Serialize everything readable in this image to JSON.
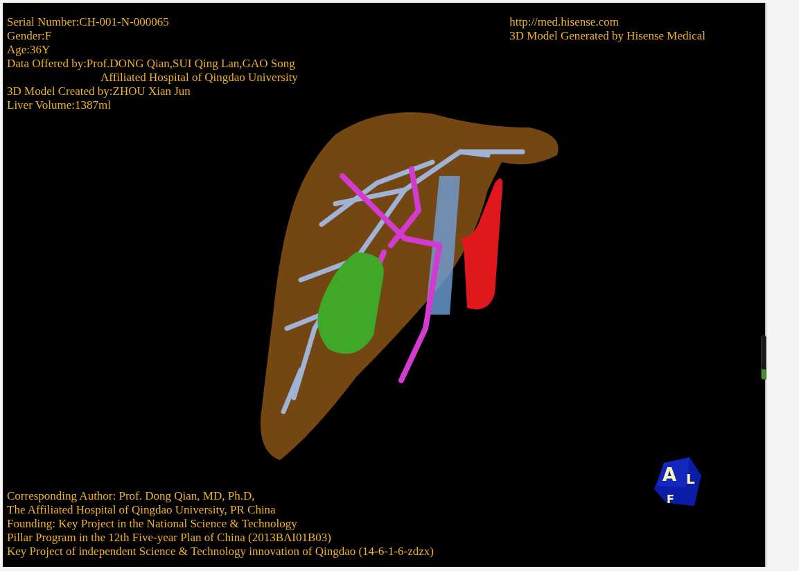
{
  "info_top_left": [
    {
      "text": "Serial Number:CH-001-N-000065"
    },
    {
      "text": "Gender:F"
    },
    {
      "text": "Age:36Y"
    },
    {
      "text": "Data Offered by:Prof.DONG Qian,SUI Qing Lan,GAO Song",
      "continuation": "Affiliated Hospital of Qingdao University"
    },
    {
      "text": "3D Model Created by:ZHOU Xian Jun"
    },
    {
      "text": "Liver Volume:1387ml"
    }
  ],
  "info_top_right": [
    "http://med.hisense.com",
    "3D Model Generated by Hisense Medical"
  ],
  "info_bottom": [
    "Corresponding Author: Prof. Dong Qian, MD, Ph.D,",
    "The Affiliated Hospital of Qingdao University, PR China",
    "Founding: Key Project in the National Science & Technology",
    "Pillar Program in the 12th Five-year Plan of China (2013BAI01B03)",
    "Key Project of independent Science & Technology innovation of Qingdao (14-6-1-6-zdzx)"
  ],
  "orientation_cube": {
    "faces": [
      "A",
      "L",
      "F"
    ]
  },
  "side_meter": {
    "level": 0.22
  }
}
